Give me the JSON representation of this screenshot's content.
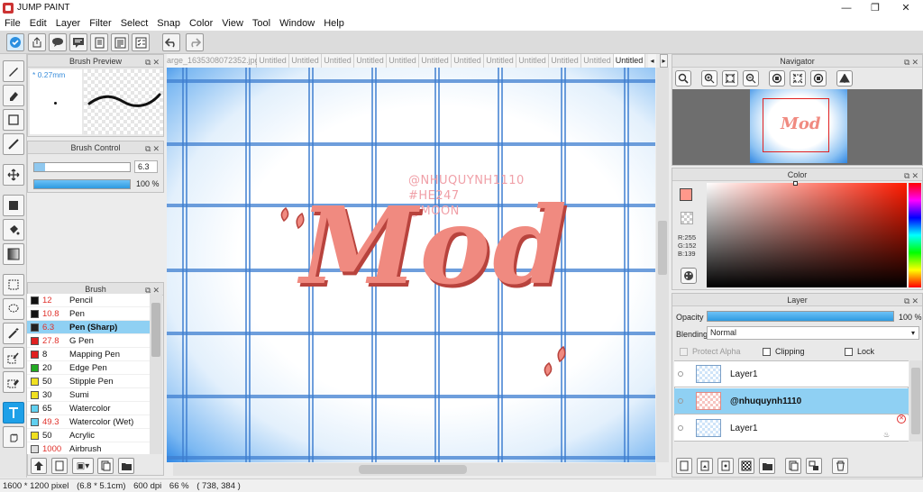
{
  "app": {
    "title": "JUMP PAINT"
  },
  "window_controls": {
    "minimize": "—",
    "maximize": "❐",
    "close": "✕"
  },
  "menu": [
    "File",
    "Edit",
    "Layer",
    "Filter",
    "Select",
    "Snap",
    "Color",
    "View",
    "Tool",
    "Window",
    "Help"
  ],
  "tabs": [
    {
      "label": "arge_1635308072352.jpg",
      "active": false
    },
    {
      "label": "Untitled",
      "active": false
    },
    {
      "label": "Untitled",
      "active": false
    },
    {
      "label": "Untitled",
      "active": false
    },
    {
      "label": "Untitled",
      "active": false
    },
    {
      "label": "Untitled",
      "active": false
    },
    {
      "label": "Untitled",
      "active": false
    },
    {
      "label": "Untitled",
      "active": false
    },
    {
      "label": "Untitled",
      "active": false
    },
    {
      "label": "Untitled",
      "active": false
    },
    {
      "label": "Untitled",
      "active": false
    },
    {
      "label": "Untitled",
      "active": false
    },
    {
      "label": "Untitled",
      "active": true
    }
  ],
  "brush_preview": {
    "title": "Brush Preview",
    "size_label": "* 0.27mm"
  },
  "brush_control": {
    "title": "Brush Control",
    "size_value": "6.3",
    "opacity_value": "100 %"
  },
  "brush_panel": {
    "title": "Brush",
    "items": [
      {
        "size": "12",
        "name": "Pencil",
        "color": "#111111",
        "red": true
      },
      {
        "size": "10.8",
        "name": "Pen",
        "color": "#111111",
        "red": true
      },
      {
        "size": "6.3",
        "name": "Pen (Sharp)",
        "color": "#222222",
        "red": true,
        "selected": true
      },
      {
        "size": "27.8",
        "name": "G Pen",
        "color": "#e02020",
        "red": true
      },
      {
        "size": "8",
        "name": "Mapping Pen",
        "color": "#e02020",
        "red": false
      },
      {
        "size": "20",
        "name": "Edge Pen",
        "color": "#22aa22",
        "red": false
      },
      {
        "size": "50",
        "name": "Stipple Pen",
        "color": "#f0e020",
        "red": false
      },
      {
        "size": "30",
        "name": "Sumi",
        "color": "#f0e020",
        "red": false
      },
      {
        "size": "65",
        "name": "Watercolor",
        "color": "#60d0f0",
        "red": false
      },
      {
        "size": "49.3",
        "name": "Watercolor (Wet)",
        "color": "#60d0f0",
        "red": true
      },
      {
        "size": "50",
        "name": "Acrylic",
        "color": "#f0e020",
        "red": false
      },
      {
        "size": "1000",
        "name": "Airbrush",
        "color": "#dddddd",
        "red": true
      }
    ]
  },
  "canvas": {
    "text_lines": [
      "@NHUQUYNH1110",
      "#HE247",
      "@MOON"
    ],
    "art_text": "Mod"
  },
  "navigator": {
    "title": "Navigator"
  },
  "color_panel": {
    "title": "Color",
    "r": "R:255",
    "g": "G:152",
    "b": "B:139",
    "fg": "#ff988b"
  },
  "layer_panel": {
    "title": "Layer",
    "opacity_label": "Opacity",
    "opacity_value": "100 %",
    "blending_label": "Blending",
    "blending_value": "Normal",
    "protect_alpha": "Protect Alpha",
    "clipping": "Clipping",
    "lock": "Lock",
    "layers": [
      {
        "name": "Layer1",
        "selected": false
      },
      {
        "name": "@nhuquynh1110",
        "selected": true
      },
      {
        "name": "Layer1",
        "selected": false
      }
    ]
  },
  "status": {
    "dimensions": "1600 * 1200 pixel",
    "physical": "(6.8 * 5.1cm)",
    "dpi": "600 dpi",
    "zoom": "66 %",
    "coords": "( 738, 384 )"
  }
}
